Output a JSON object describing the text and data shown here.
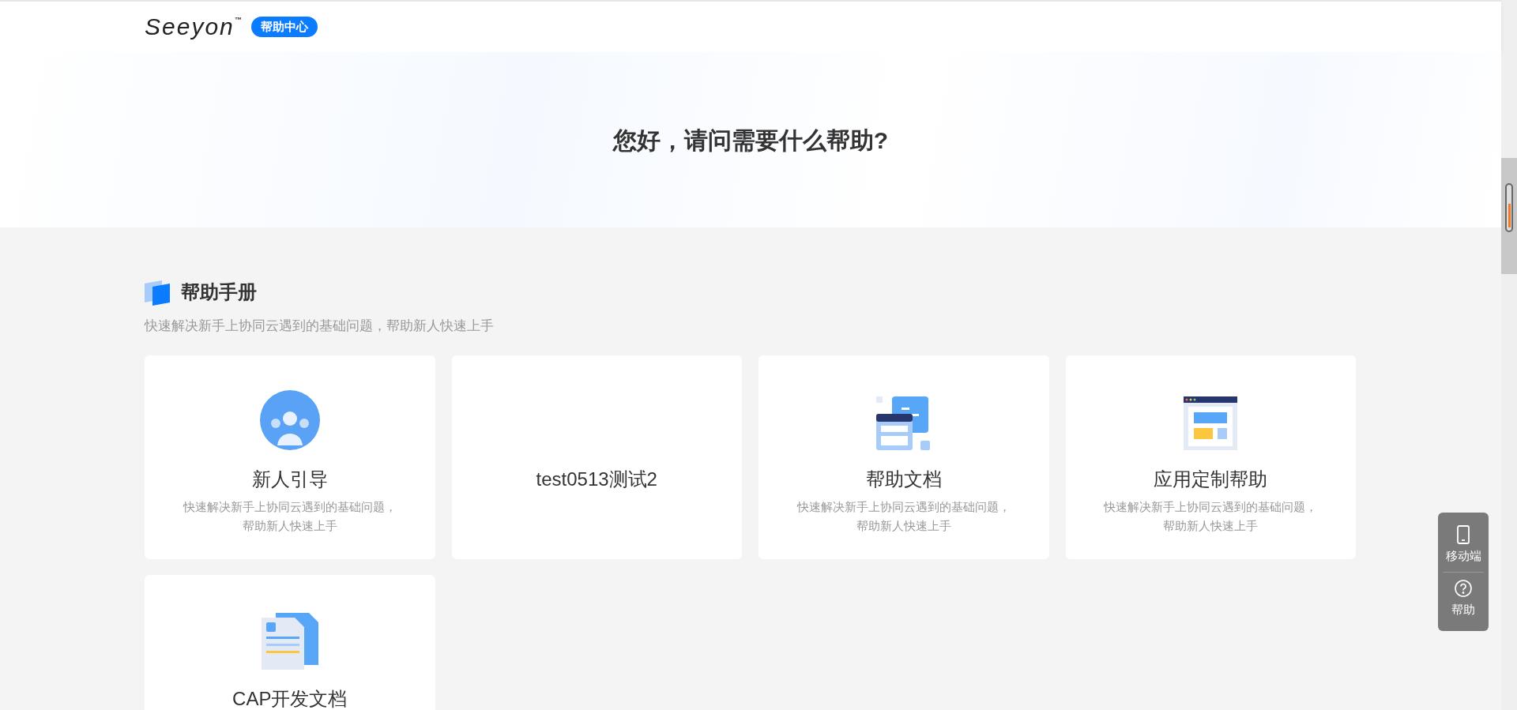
{
  "header": {
    "logo": "Seeyon",
    "trademark": "™",
    "badge": "帮助中心"
  },
  "hero": {
    "title": "您好，请问需要什么帮助?"
  },
  "section": {
    "title": "帮助手册",
    "subtitle": "快速解决新手上协同云遇到的基础问题，帮助新人快速上手"
  },
  "cards": [
    {
      "kind": "people",
      "title": "新人引导",
      "description": "快速解决新手上协同云遇到的基础问题，帮助新人快速上手"
    },
    {
      "kind": "none",
      "title": "test0513测试2"
    },
    {
      "kind": "windows",
      "title": "帮助文档",
      "description": "快速解决新手上协同云遇到的基础问题，帮助新人快速上手"
    },
    {
      "kind": "browser",
      "title": "应用定制帮助",
      "description": "快速解决新手上协同云遇到的基础问题，帮助新人快速上手"
    },
    {
      "kind": "documents",
      "title": "CAP开发文档"
    }
  ],
  "float_menu": [
    {
      "kind": "mobile",
      "label": "移动端"
    },
    {
      "kind": "help",
      "label": "帮助"
    }
  ]
}
